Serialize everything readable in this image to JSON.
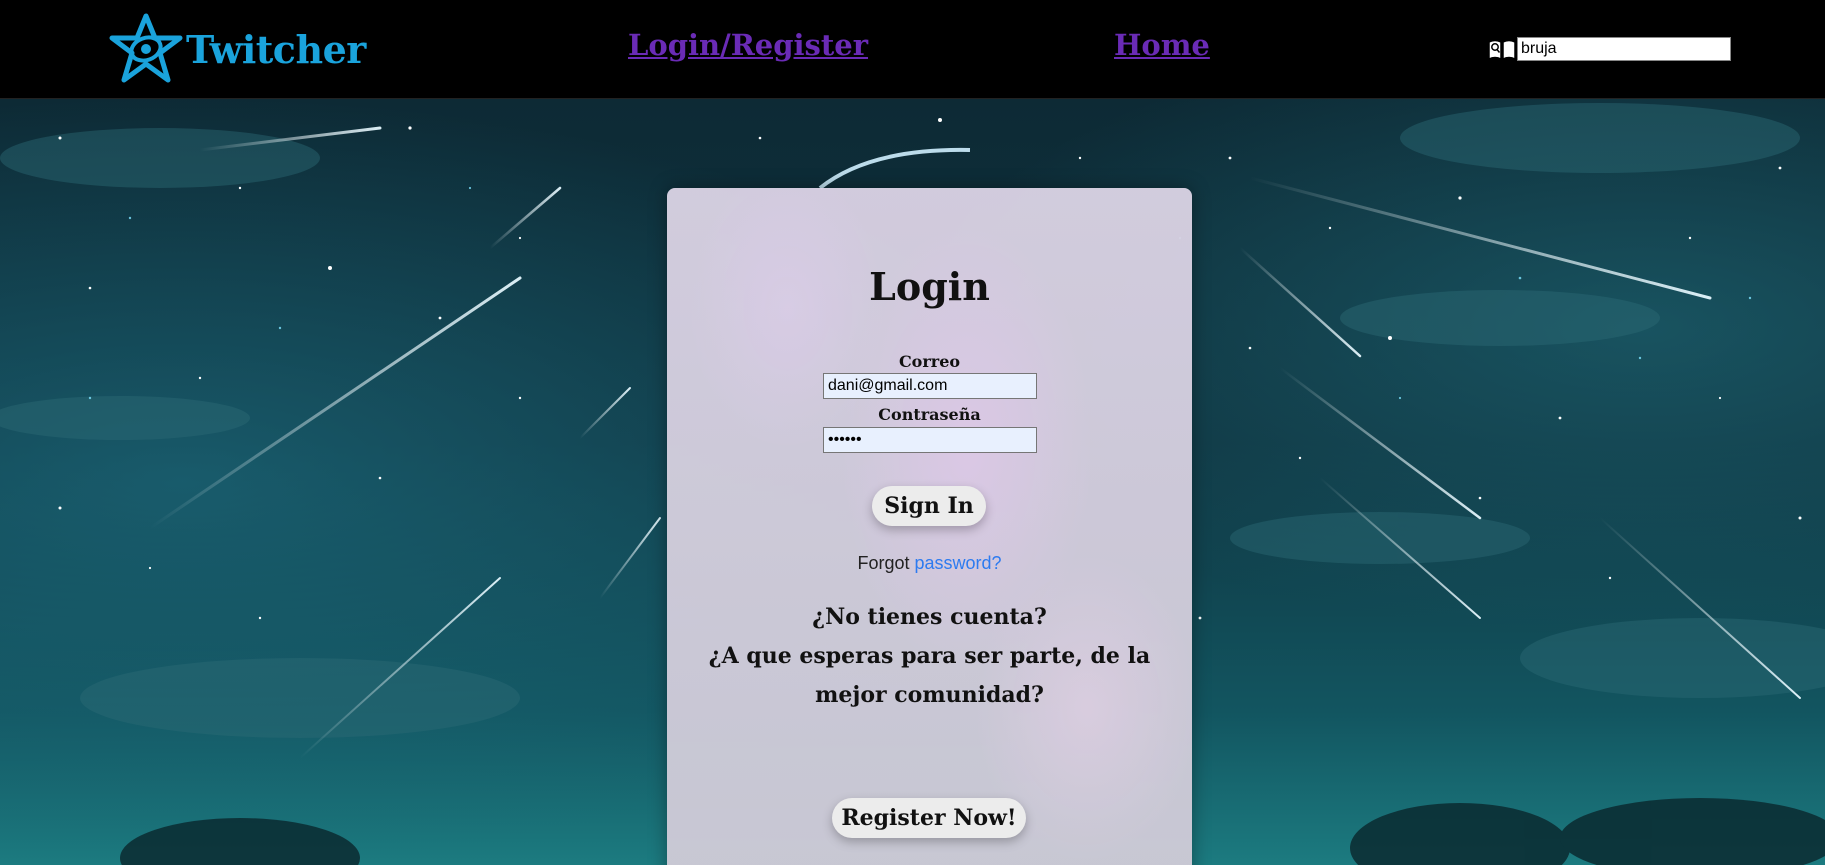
{
  "header": {
    "brand_name": "Twitcher",
    "nav_login": "Login/Register",
    "nav_home": "Home",
    "search_value": "bruja",
    "brand_color": "#1aa3dc",
    "link_color": "#6a2bb6"
  },
  "login": {
    "title": "Login",
    "email_label": "Correo",
    "email_value": "dani@gmail.com",
    "password_label": "Contraseña",
    "password_value": "dani12",
    "signin_label": "Sign In",
    "forgot_prefix": "Forgot",
    "forgot_link": "password?",
    "promo_line1": "¿No tienes cuenta?",
    "promo_line2": "¿A que esperas para ser parte, de la mejor comunidad?",
    "register_label": "Register Now!"
  },
  "icons": {
    "brand_logo": "star-logo-icon",
    "search": "book-search-icon"
  }
}
